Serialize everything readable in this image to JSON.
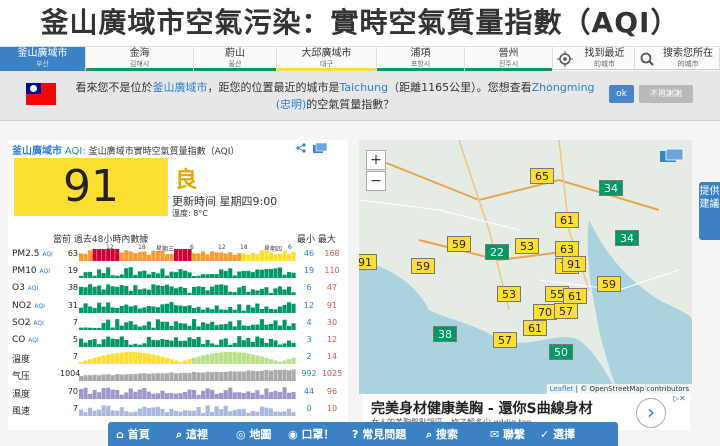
{
  "title": "釜山廣域市空氣污染：實時空氣質量指數（AQI）",
  "nav": [
    {
      "label": "釜山廣域市",
      "sub": "부산",
      "active": true
    },
    {
      "label": "金海",
      "sub": "김해시"
    },
    {
      "label": "蔚山",
      "sub": "울산"
    },
    {
      "label": "大邱廣域市",
      "sub": "대구"
    },
    {
      "label": "浦項",
      "sub": "포항시"
    },
    {
      "label": "晉州",
      "sub": "진주시"
    },
    {
      "label": "找到最近",
      "sub": "的城市"
    },
    {
      "label": "搜索您所在",
      "sub": "的城市"
    }
  ],
  "banner": {
    "line1a": "看來您不是位於",
    "city": "釜山廣域市",
    "line1b": "，距您的位置最近的城市是",
    "nearest": "Taichung",
    "line1c": "（距離1165公里）。您想查看",
    "suggest": "Zhongming",
    "suggest2": "(忠明)",
    "line2": "的空氣質量指數？",
    "ok": "ok",
    "no": "不用謝謝"
  },
  "panel": {
    "city": "釜山廣域市",
    "aqi_label": "AQI:",
    "subtitle": "釜山廣域市實時空氣質量指數（AQI）",
    "aqi": "91",
    "grade": "良",
    "updated": "更新時间 星期四9:00",
    "temp": "溫度: 8°C",
    "hist_title": "當前 過去48小時內數據",
    "minmax": "最小 最大",
    "ticks": [
      "12",
      "18",
      "星期三",
      "6",
      "12",
      "18",
      "星期四",
      "6"
    ]
  },
  "pollutants": [
    {
      "name": "PM2.5",
      "tag": "AQI",
      "cur": "63",
      "min": "46",
      "max": "168",
      "type": "pm25"
    },
    {
      "name": "PM10",
      "tag": "AQI",
      "cur": "19",
      "min": "19",
      "max": "110",
      "type": "g"
    },
    {
      "name": "O3",
      "tag": "AQI",
      "cur": "38",
      "min": "6",
      "max": "47",
      "type": "g"
    },
    {
      "name": "NO2",
      "tag": "AQI",
      "cur": "31",
      "min": "12",
      "max": "91",
      "type": "g"
    },
    {
      "name": "SO2",
      "tag": "AQI",
      "cur": "7",
      "min": "4",
      "max": "30",
      "type": "g"
    },
    {
      "name": "CO",
      "tag": "AQI",
      "cur": "5",
      "min": "3",
      "max": "12",
      "type": "g"
    },
    {
      "name": "溫度",
      "tag": "",
      "cur": "7",
      "min": "2",
      "max": "14",
      "type": "temp"
    },
    {
      "name": "气压",
      "tag": "",
      "cur": "1004",
      "min": "992",
      "max": "1025",
      "type": "press"
    },
    {
      "name": "濕度",
      "tag": "",
      "cur": "70",
      "min": "44",
      "max": "96",
      "type": "hum"
    },
    {
      "name": "風速",
      "tag": "",
      "cur": "7",
      "min": "0",
      "max": "10",
      "type": "wind"
    }
  ],
  "map": {
    "zoom_in": "+",
    "zoom_out": "−",
    "attrib_leaflet": "Leaflet",
    "attrib_rest": "| © OpenStreetMap contributors",
    "markers": [
      {
        "v": "65",
        "c": "y"
      },
      {
        "v": "34",
        "c": "g"
      },
      {
        "v": "61",
        "c": "y"
      },
      {
        "v": "34",
        "c": "g"
      },
      {
        "v": "59",
        "c": "y"
      },
      {
        "v": "22",
        "c": "g"
      },
      {
        "v": "53",
        "c": "y"
      },
      {
        "v": "63",
        "c": "y"
      },
      {
        "v": "91",
        "c": "y"
      },
      {
        "v": "70",
        "c": "y"
      },
      {
        "v": "59",
        "c": "y"
      },
      {
        "v": "91",
        "c": "y"
      },
      {
        "v": "59",
        "c": "y"
      },
      {
        "v": "53",
        "c": "y"
      },
      {
        "v": "55",
        "c": "y"
      },
      {
        "v": "61",
        "c": "y"
      },
      {
        "v": "70",
        "c": "y"
      },
      {
        "v": "57",
        "c": "y"
      },
      {
        "v": "61",
        "c": "y"
      },
      {
        "v": "38",
        "c": "g"
      },
      {
        "v": "57",
        "c": "y"
      },
      {
        "v": "50",
        "c": "g"
      }
    ]
  },
  "ad": {
    "title": "完美身材健康美胸 - 還你S曲線身材",
    "sub": "女人的美胸盤點誤區，妳了解多少 qddig.top"
  },
  "side": "提供建議",
  "footer": [
    "首頁",
    "這裡",
    "地圖",
    "口罩！",
    "常見問題",
    "搜索",
    "聯繫",
    "選擇"
  ],
  "colors": {
    "good": "#009966",
    "moderate": "#ffde33",
    "unhealthy": "#cc0033",
    "accent": "#3b82c4"
  }
}
